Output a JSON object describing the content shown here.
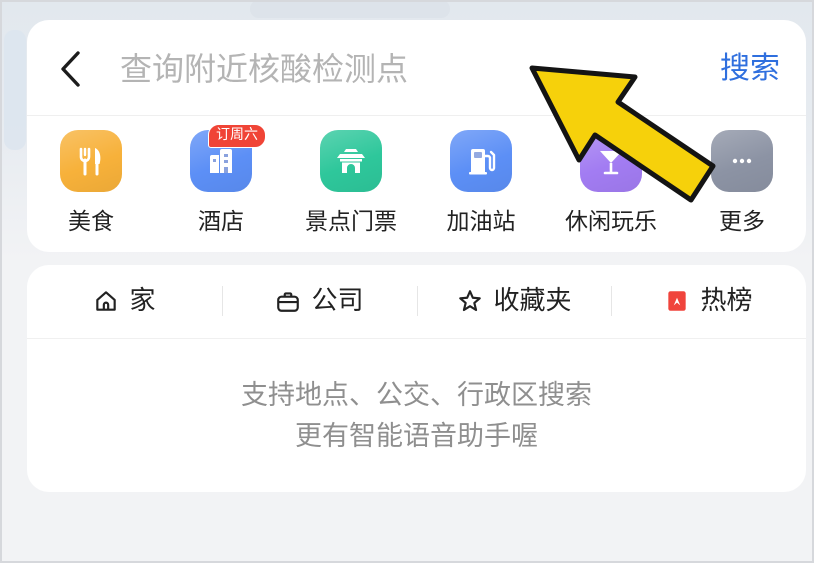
{
  "search": {
    "back_icon": "back-arrow-icon",
    "placeholder": "查询附近核酸检测点",
    "button_label": "搜索"
  },
  "categories": {
    "items": [
      {
        "label": "美食",
        "icon": "fork-knife-icon",
        "color": "#f7b13a"
      },
      {
        "label": "酒店",
        "icon": "hotel-building-icon",
        "color": "#5c8ff6",
        "badge": "订周六"
      },
      {
        "label": "景点门票",
        "icon": "scenic-gate-icon",
        "color": "#2ec79b"
      },
      {
        "label": "加油站",
        "icon": "gas-pump-icon",
        "color": "#5c8ff6"
      },
      {
        "label": "休闲玩乐",
        "icon": "cocktail-icon",
        "color": "#a27cf2"
      },
      {
        "label": "更多",
        "icon": "more-dots-icon",
        "color": "#8c93a4"
      }
    ]
  },
  "quick_links": {
    "items": [
      {
        "label": "家",
        "icon": "home-icon"
      },
      {
        "label": "公司",
        "icon": "briefcase-icon"
      },
      {
        "label": "收藏夹",
        "icon": "star-icon"
      },
      {
        "label": "热榜",
        "icon": "hot-list-icon",
        "color": "#f0443c"
      }
    ]
  },
  "hint": {
    "lines": [
      "支持地点、公交、行政区搜索",
      "更有智能语音助手喔"
    ]
  },
  "theme": {
    "accent": "#2f6fde",
    "badge": "#f04436"
  },
  "annotation_arrow": {
    "fill": "#f6d10b",
    "outline": "#141414"
  }
}
